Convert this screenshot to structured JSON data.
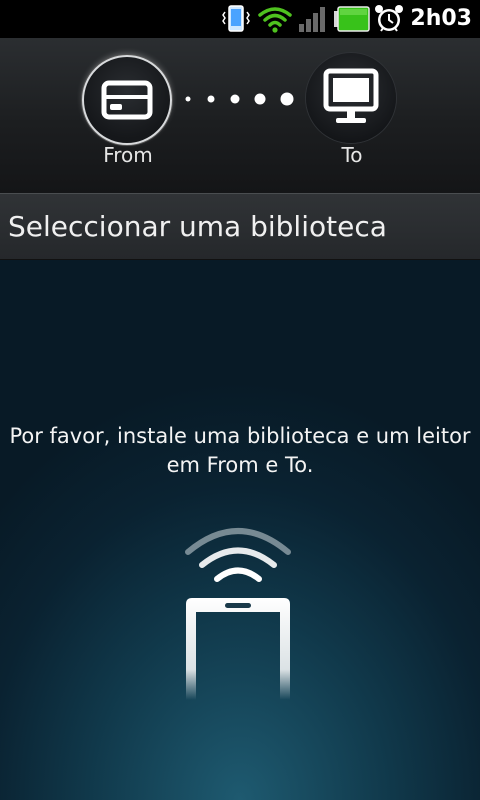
{
  "status_bar": {
    "time": "2h03",
    "icons": [
      "vibrate-icon",
      "wifi-icon",
      "signal-icon",
      "battery-icon",
      "alarm-clock-icon"
    ],
    "battery_color": "#38c21a"
  },
  "header": {
    "from_label": "From",
    "to_label": "To",
    "from_icon": "storage-drive-icon",
    "to_icon": "monitor-icon"
  },
  "title": "Seleccionar uma biblioteca",
  "message": {
    "line1": "Por favor, instale uma biblioteca e um leitor",
    "line2": "em From e To."
  },
  "illustration": "phone-wireless-icon"
}
